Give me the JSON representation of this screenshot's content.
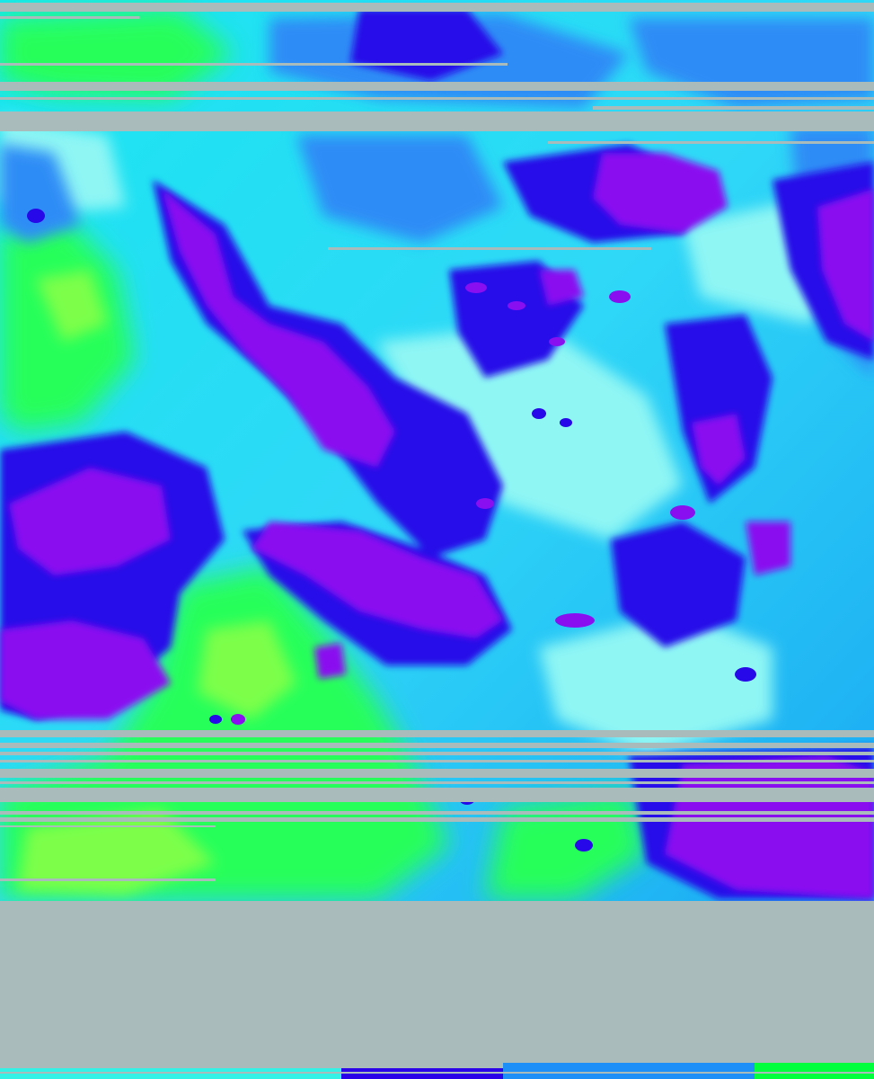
{
  "image": {
    "kind": "false-color infrared satellite imagery",
    "colors": {
      "no_data": "#a9bcbb",
      "warm_surface": "#00ff3c",
      "low_cloud": "#34f2e6",
      "mid_cloud": "#1d8ff7",
      "high_cloud": "#2b00e8",
      "coldest_tops": "#8a0af0"
    }
  }
}
